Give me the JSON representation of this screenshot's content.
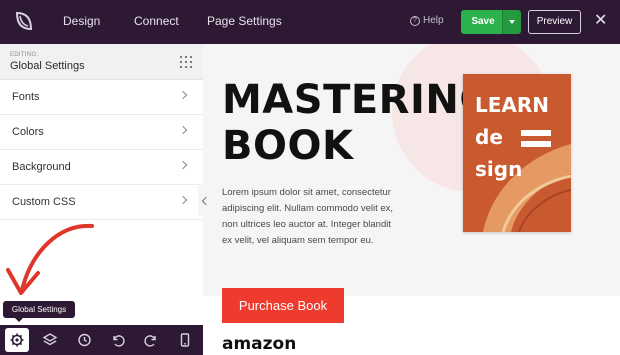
{
  "topbar": {
    "nav": [
      "Design",
      "Connect",
      "Page Settings"
    ],
    "help_label": "Help",
    "save_label": "Save",
    "preview_label": "Preview",
    "close_symbol": "✕"
  },
  "sidebar": {
    "editing_label": "EDITING:",
    "panel_title": "Global Settings",
    "items": [
      {
        "label": "Fonts"
      },
      {
        "label": "Colors"
      },
      {
        "label": "Background"
      },
      {
        "label": "Custom CSS"
      }
    ],
    "tooltip": "Global Settings",
    "bottom_icons": [
      "gear-icon",
      "layers-icon",
      "history-icon",
      "undo-icon",
      "redo-icon",
      "mobile-preview-icon"
    ]
  },
  "canvas": {
    "headline_line1": "MASTERING",
    "headline_line2": "BOOK",
    "body": "Lorem ipsum dolor sit amet, consectetur adipiscing elit. Nullam commodo velit ex, non ultrices leo auctor at. Integer blandit ex velit, vel aliquam sem tempor eu.",
    "book_cover": {
      "line1": "LEARN",
      "line2": "de",
      "line3": "sign"
    },
    "purchase_label": "Purchase Book",
    "amazon_label": "amazon"
  },
  "colors": {
    "topbar": "#2e1935",
    "save": "#2bb24c",
    "purchase": "#ee3b2e",
    "book_cover": "#c95a2f",
    "annotation_arrow": "#e0352b"
  }
}
